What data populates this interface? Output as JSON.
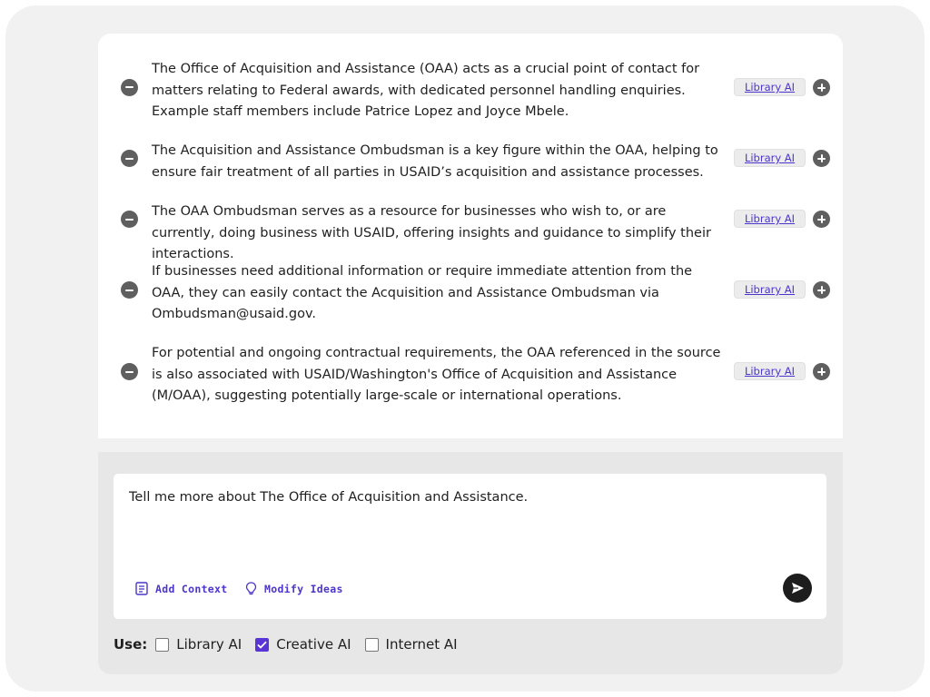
{
  "ideas": [
    {
      "text": "The Office of Acquisition and Assistance (OAA) acts as a crucial point of contact for matters relating to Federal awards, with dedicated personnel handling enquiries. Example staff members include Patrice Lopez and Joyce Mbele.",
      "source": "Library AI"
    },
    {
      "text": "The Acquisition and Assistance Ombudsman is a key figure within the OAA, helping to ensure fair treatment of all parties in USAID’s acquisition and assistance processes.",
      "source": "Library AI"
    },
    {
      "text": "The OAA Ombudsman serves as a resource for businesses who wish to, or are currently, doing business with USAID, offering insights and guidance to simplify their interactions.",
      "source": "Library AI"
    },
    {
      "text": "If businesses need additional information or require immediate attention from the OAA, they can easily contact the Acquisition and Assistance Ombudsman via Ombudsman@usaid.gov.",
      "source": "Library AI"
    },
    {
      "text": "For potential and ongoing contractual requirements, the OAA referenced in the source is also associated with USAID/Washington's Office of Acquisition and Assistance (M/OAA), suggesting potentially large-scale or international operations.",
      "source": "Library AI"
    }
  ],
  "composer": {
    "prompt": "Tell me more about The Office of Acquisition and Assistance.",
    "add_context_label": "Add Context",
    "modify_ideas_label": "Modify Ideas",
    "send_icon": "send-icon"
  },
  "use": {
    "label": "Use:",
    "options": [
      {
        "label": "Library AI",
        "checked": false
      },
      {
        "label": "Creative AI",
        "checked": true
      },
      {
        "label": "Internet AI",
        "checked": false
      }
    ]
  },
  "colors": {
    "accent": "#4b36c9",
    "checkbox_checked": "#5a35d6",
    "icon_gray": "#5f5f5f",
    "send_button": "#1d1d1d"
  }
}
